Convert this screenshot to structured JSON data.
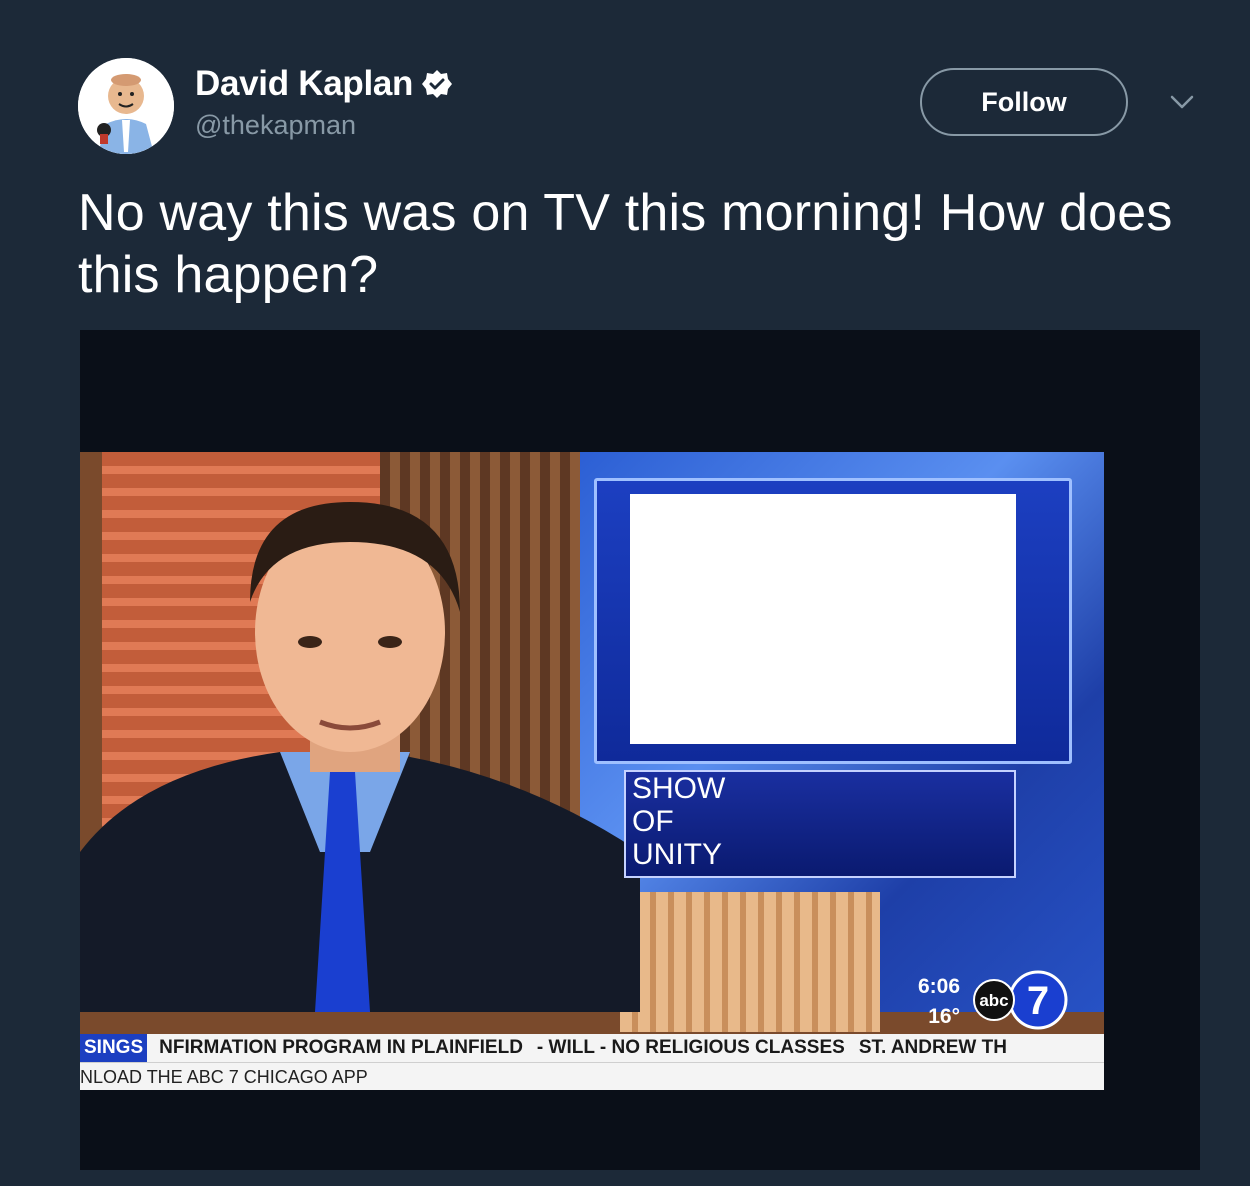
{
  "user": {
    "display_name": "David Kaplan",
    "handle": "@thekapman",
    "verified": true
  },
  "actions": {
    "follow_label": "Follow"
  },
  "tweet": {
    "text": "No way this was on TV this morning! How does this happen?"
  },
  "media": {
    "graphic_lines": [
      "SHOW",
      "OF",
      "UNITY"
    ],
    "clock_time": "6:06",
    "temperature": "16°",
    "station_logo_text": "abc",
    "station_number": "7",
    "ticker_tag": "SINGS",
    "ticker_headline": "NFIRMATION PROGRAM IN PLAINFIELD",
    "ticker_item_2": "- WILL - NO RELIGIOUS CLASSES",
    "ticker_item_3": "ST. ANDREW TH",
    "ticker_bottom": "NLOAD THE ABC 7 CHICAGO APP"
  },
  "colors": {
    "background": "#1c2938",
    "accent_blue": "#1da1f2",
    "muted": "#8899a6"
  },
  "icons": {
    "verified": "verified-badge-icon",
    "caret": "chevron-down-icon"
  }
}
